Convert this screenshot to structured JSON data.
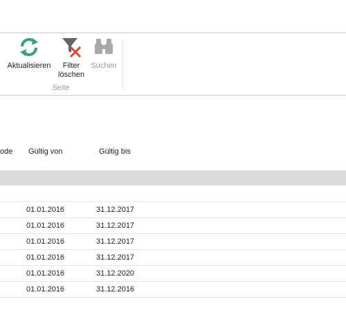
{
  "ribbon": {
    "refresh_label": "Aktualisieren",
    "filter_label_line1": "Filter",
    "filter_label_line2": "löschen",
    "search_label": "Suchen",
    "group_label": "Seite"
  },
  "table": {
    "headers": {
      "code_partial": "ode",
      "valid_from": "Gültig von",
      "valid_to": "Gültig bis"
    },
    "rows": [
      {
        "from": "",
        "to": ""
      },
      {
        "from": "01.01.2016",
        "to": "31.12.2017"
      },
      {
        "from": "01.01.2016",
        "to": "31.12.2017"
      },
      {
        "from": "01.01.2016",
        "to": "31.12.2017"
      },
      {
        "from": "01.01.2016",
        "to": "31.12.2017"
      },
      {
        "from": "01.01.2016",
        "to": "31.12.2020"
      },
      {
        "from": "01.01.2016",
        "to": "31.12.2016"
      }
    ]
  },
  "colors": {
    "refresh_green": "#3aa07a",
    "filter_red": "#d9452b",
    "filter_gray": "#666666",
    "disabled_gray": "#a8a8a8",
    "filter_row_bg": "#dcdcdc"
  }
}
